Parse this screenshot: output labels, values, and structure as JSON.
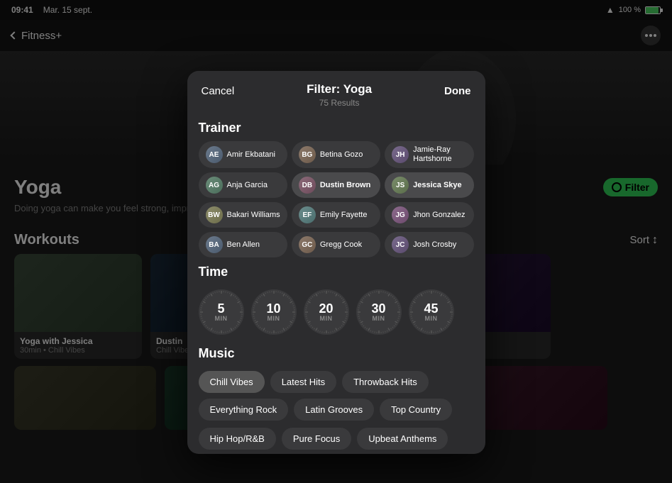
{
  "statusBar": {
    "time": "09:41",
    "date": "Mar. 15 sept.",
    "battery": "100 %"
  },
  "topNav": {
    "backLabel": "Fitness+",
    "dotsLabel": "more-options"
  },
  "yogaSection": {
    "title": "Yoga",
    "description": "Doing yoga can make you feel strong, improve balance, and encourage min...",
    "filterLabel": "Filter",
    "workoutsLabel": "Workouts",
    "sortLabel": "Sort"
  },
  "workoutCards": [
    {
      "title": "Yoga with Jessica",
      "meta": "30min • Chill Vibes"
    },
    {
      "title": "Dustin",
      "meta": "Chill Vibes"
    }
  ],
  "modal": {
    "cancelLabel": "Cancel",
    "title": "Filter: Yoga",
    "subtitle": "75 Results",
    "doneLabel": "Done",
    "trainerSectionLabel": "Trainer",
    "timeSectionLabel": "Time",
    "musicSectionLabel": "Music"
  },
  "trainers": [
    {
      "name": "Amir Ekbatani",
      "initials": "AE",
      "av": "av-1",
      "selected": false
    },
    {
      "name": "Betina Gozo",
      "initials": "BG",
      "av": "av-2",
      "selected": false
    },
    {
      "name": "Jamie-Ray Hartshorne",
      "initials": "JH",
      "av": "av-3",
      "selected": false
    },
    {
      "name": "Anja Garcia",
      "initials": "AG",
      "av": "av-4",
      "selected": false
    },
    {
      "name": "Dustin Brown",
      "initials": "DB",
      "av": "av-5",
      "selected": true,
      "bold": true
    },
    {
      "name": "Jessica Skye",
      "initials": "JS",
      "av": "av-6",
      "selected": true,
      "bold": true
    },
    {
      "name": "Bakari Williams",
      "initials": "BW",
      "av": "av-7",
      "selected": false
    },
    {
      "name": "Emily Fayette",
      "initials": "EF",
      "av": "av-8",
      "selected": false
    },
    {
      "name": "Jhon Gonzalez",
      "initials": "JG",
      "av": "av-9",
      "selected": false
    },
    {
      "name": "Ben Allen",
      "initials": "BA",
      "av": "av-1",
      "selected": false
    },
    {
      "name": "Gregg Cook",
      "initials": "GC",
      "av": "av-2",
      "selected": false
    },
    {
      "name": "Josh Crosby",
      "initials": "JC",
      "av": "av-3",
      "selected": false
    }
  ],
  "timeOptions": [
    {
      "value": "5",
      "unit": "MIN",
      "selected": false
    },
    {
      "value": "10",
      "unit": "MIN",
      "selected": true
    },
    {
      "value": "20",
      "unit": "MIN",
      "selected": true
    },
    {
      "value": "30",
      "unit": "MIN",
      "selected": true
    },
    {
      "value": "45",
      "unit": "MIN",
      "selected": false
    }
  ],
  "musicOptions": [
    {
      "label": "Chill Vibes",
      "selected": true
    },
    {
      "label": "Latest Hits",
      "selected": false
    },
    {
      "label": "Throwback Hits",
      "selected": false
    },
    {
      "label": "Everything Rock",
      "selected": false
    },
    {
      "label": "Latin Grooves",
      "selected": false
    },
    {
      "label": "Top Country",
      "selected": false
    }
  ],
  "moreMusicOptions": [
    {
      "label": "Hip Hop/R&B"
    },
    {
      "label": "Pure Focus"
    },
    {
      "label": "Upbeat Anthems"
    }
  ]
}
